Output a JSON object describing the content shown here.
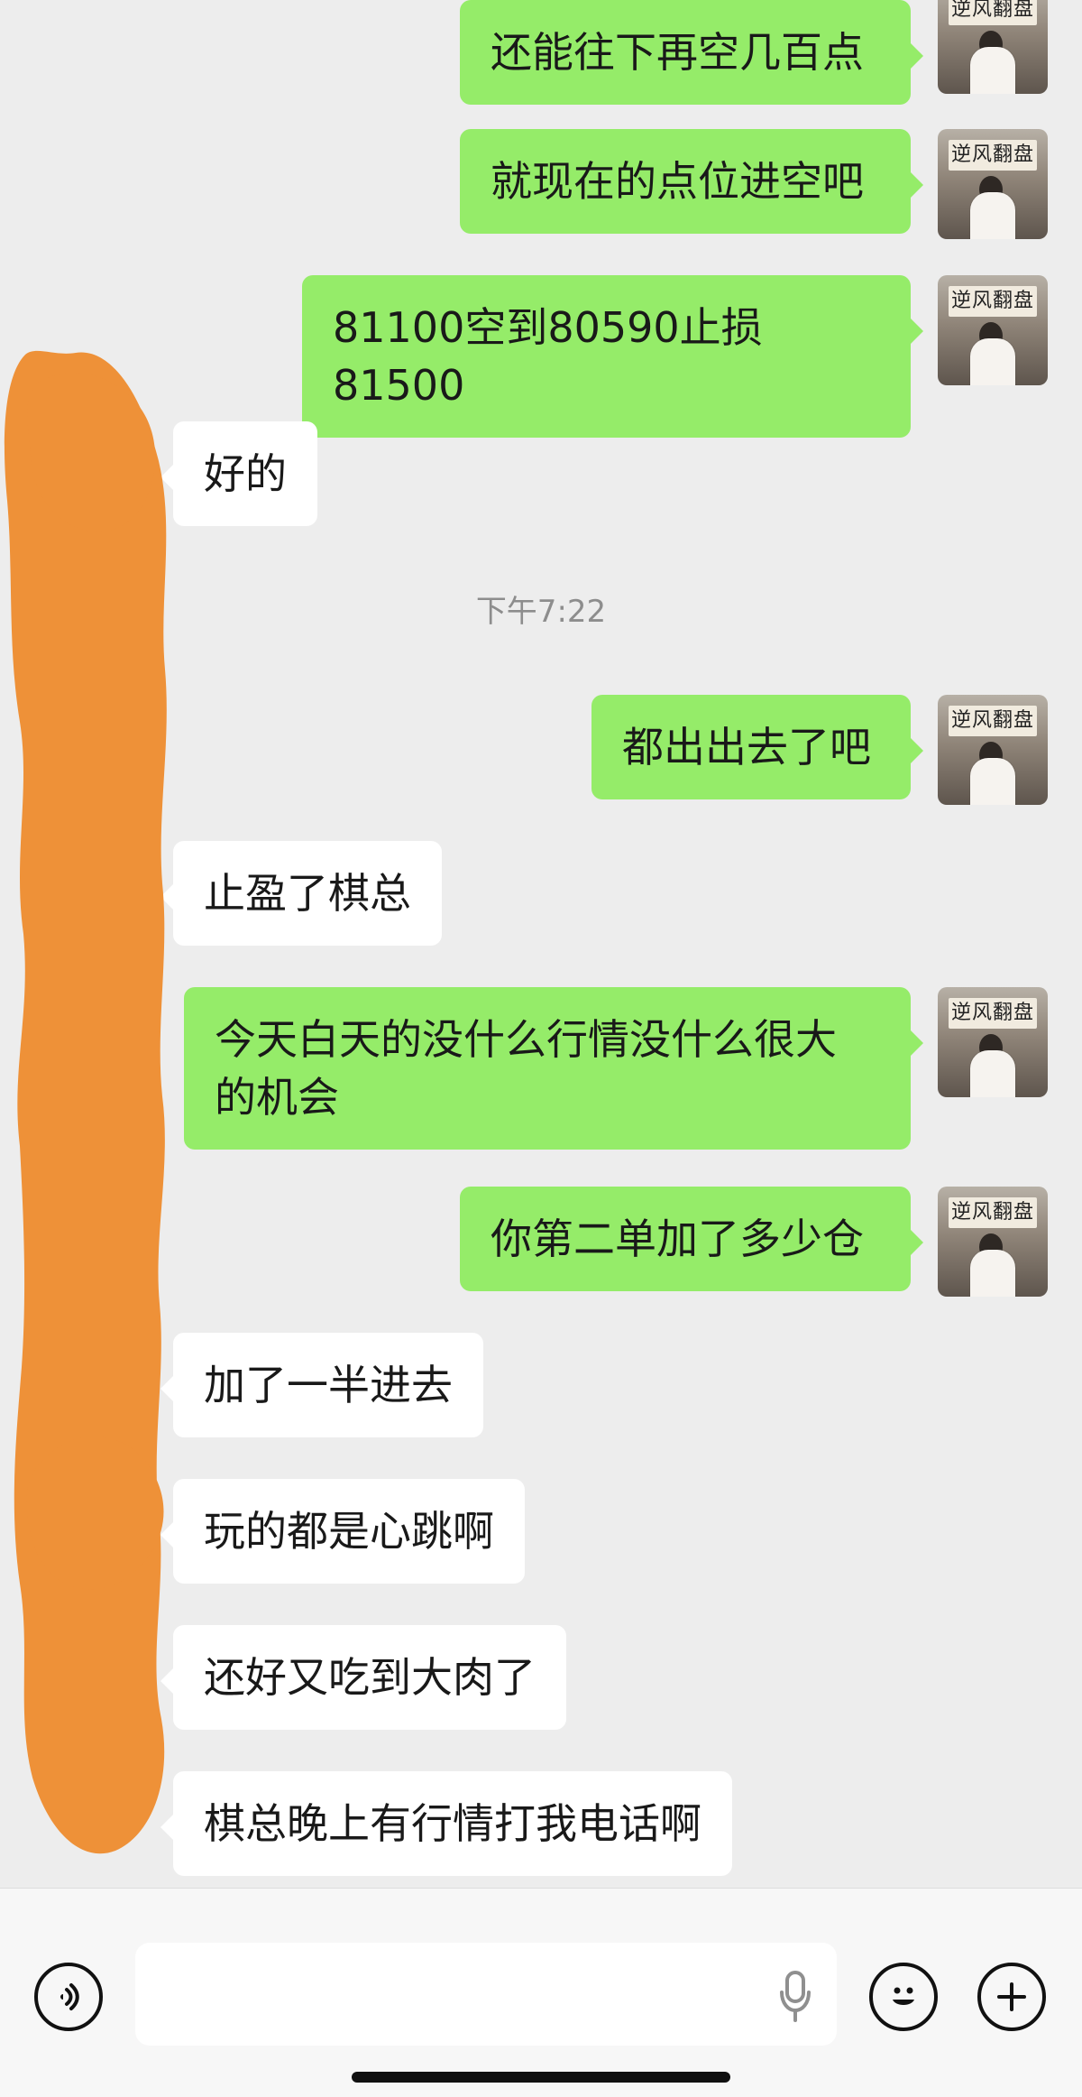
{
  "chat": {
    "timestamp": "下午7:22",
    "messages": [
      {
        "side": "right",
        "text": "还能往下再空几百点"
      },
      {
        "side": "right",
        "text": "就现在的点位进空吧"
      },
      {
        "side": "right",
        "text": "81100空到80590止损81500"
      },
      {
        "side": "left",
        "text": "好的"
      },
      {
        "side": "right",
        "text": "都出出去了吧"
      },
      {
        "side": "left",
        "text": "止盈了棋总"
      },
      {
        "side": "right",
        "text": "今天白天的没什么行情没什么很大\n的机会"
      },
      {
        "side": "right",
        "text": "你第二单加了多少仓"
      },
      {
        "side": "left",
        "text": "加了一半进去"
      },
      {
        "side": "left",
        "text": "玩的都是心跳啊"
      },
      {
        "side": "left",
        "text": "还好又吃到大肉了"
      },
      {
        "side": "left",
        "text": "棋总晚上有行情打我电话啊"
      }
    ],
    "avatar": {
      "sign_text": "逆风翻盘"
    }
  },
  "input_bar": {
    "text_value": "",
    "placeholder": ""
  },
  "colors": {
    "background": "#ededed",
    "right_bubble": "#95ec69",
    "left_bubble": "#ffffff",
    "redaction": "#ee9138"
  },
  "icons": [
    "voice-icon",
    "mic-icon",
    "emoji-icon",
    "plus-icon"
  ]
}
